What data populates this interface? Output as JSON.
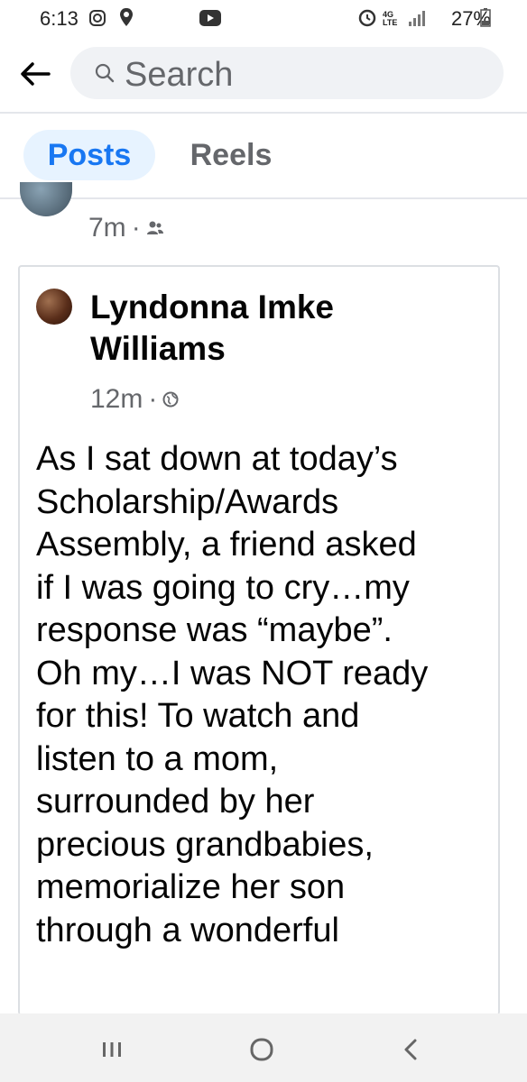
{
  "status_bar": {
    "time": "6:13",
    "network": "4G LTE",
    "battery": "27%"
  },
  "search": {
    "placeholder": "Search"
  },
  "tabs": [
    {
      "label": "Posts",
      "active": true
    },
    {
      "label": "Reels",
      "active": false
    }
  ],
  "previous_post": {
    "timestamp": "7m",
    "separator": "·",
    "audience_icon": "friends-icon"
  },
  "post": {
    "author": "Lyndonna Imke Williams",
    "timestamp": "12m",
    "separator": "·",
    "audience_icon": "globe-icon",
    "body_lines": [
      "As I sat down at today’s",
      "Scholarship/Awards",
      "Assembly, a friend asked",
      "if I was going to cry…my",
      "response was “maybe”.",
      "Oh my…I was NOT ready",
      "for this!  To watch and",
      "listen to a mom,",
      "surrounded by her",
      "precious grandbabies,",
      "memorialize her son",
      "through a wonderful"
    ]
  },
  "nav_bar": {
    "icons": [
      "recent-apps-icon",
      "home-icon",
      "back-icon"
    ]
  },
  "colors": {
    "accent": "#1877f2",
    "tab_active_bg": "#e7f3ff",
    "muted_text": "#65676b",
    "search_bg": "#f0f2f5"
  }
}
